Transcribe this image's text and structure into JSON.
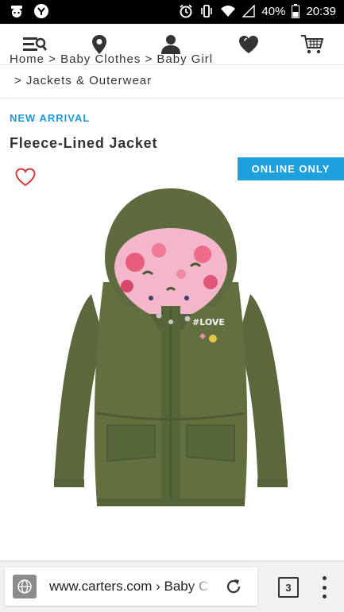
{
  "status_bar": {
    "battery": "40%",
    "time": "20:39"
  },
  "nav": {
    "items": [
      "store-locator",
      "location",
      "account",
      "wishlist",
      "cart"
    ]
  },
  "breadcrumb": {
    "line1": "Home > Baby Clothes > Baby Girl",
    "line2": "> Jackets & Outerwear"
  },
  "product": {
    "tag": "NEW ARRIVAL",
    "title": "Fleece-Lined Jacket",
    "badge": "ONLINE ONLY",
    "print_text": "#LOVE"
  },
  "browser": {
    "url": "www.carters.com › Baby Clothes",
    "tab_count": "3"
  },
  "colors": {
    "accent": "#1a9ad6",
    "badge": "#1ea0dc",
    "jacket": "#5e6b3f",
    "heart": "#d23b3b"
  }
}
